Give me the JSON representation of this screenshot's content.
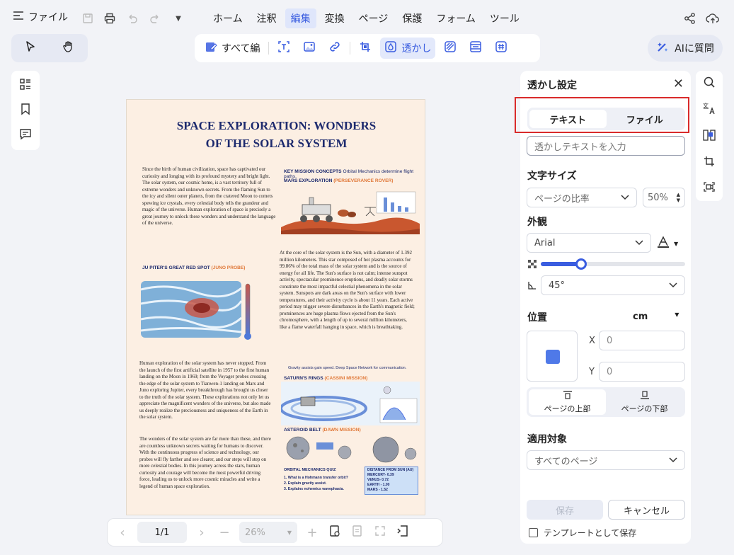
{
  "menubar": {
    "file_label": "ファイル",
    "tabs": [
      {
        "label": "ホーム",
        "active": false
      },
      {
        "label": "注釈",
        "active": false
      },
      {
        "label": "編集",
        "active": true
      },
      {
        "label": "変換",
        "active": false
      },
      {
        "label": "ページ",
        "active": false
      },
      {
        "label": "保護",
        "active": false
      },
      {
        "label": "フォーム",
        "active": false
      },
      {
        "label": "ツール",
        "active": false
      }
    ]
  },
  "toolbar": {
    "edit_all": "すべて編",
    "watermark": "透かし",
    "ai_button": "AIに質問"
  },
  "document": {
    "title_line1": "SPACE EXPLORATION: WONDERS",
    "title_line2": "OF THE SOLAR SYSTEM",
    "para1": "Since the birth of human civilization, space has captivated our curiosity and longing with its profound mystery and bright light. The solar system, our cosmic home, is a vast territory full of extreme wonders and unknown secrets. From the flaming Sun to the icy and silent outer planets, from the cratered Moon to comets spewing ice crystals, every celestial body tells the grandeur and magic of the universe. Human exploration of space is precisely a great journey to unlock these wonders and understand the language of the universe.",
    "key_mission": "KEY MISSION CONCEPTS",
    "key_mission_sub": "Orbital Mechanics determine flight paths.",
    "mars": "MARS EXPLORATION",
    "mars_sub": "(PERSEVERANCE ROVER)",
    "jupiter": "JU PITER'S GREAT RED SPOT",
    "jupiter_sub": "(JUNO PROBE)",
    "para2": "At the core of the solar system is the Sun, with a diameter of 1.392 million kilometers. This star composed of hot plasma accounts for 99.86% of the total mass of the solar system and is the source of energy for all life. The Sun's surface is not calm; intense sunspot activity, spectacular prominence eruptions, and deadly solar storms constitute the most impactful celestial phenomena in the solar system. Sunspots are dark areas on the Sun's surface with lower temperatures, and their activity cycle is about 11 years. Each active period may trigger severe disturbances in the Earth's magnetic field; prominences are huge plasma flows ejected from the Sun's chromosphere, with a length of up to several million kilometers, like a flame waterfall hanging in space, which is breathtaking.",
    "para3": "Human exploration of the solar system has never stopped. From the launch of the first artificial satellite in 1957 to the first human landing on the Moon in 1969; from the Voyager probes crossing the edge of the solar system to Tianwen-1 landing on Mars and Juno exploring Jupiter, every breakthrough has brought us closer to the truth of the solar system. These explorations not only let us appreciate the magnificent wonders of the universe, but also made us deeply realize the preciousness and uniqueness of the Earth in the solar system.",
    "para4": "The wonders of the solar system are far more than these, and there are countless unknown secrets waiting for humans to discover. With the continuous progress of science and technology, our probes will fly farther and see clearer, and our steps will step on more celestial bodies. In this journey across the stars, human curiosity and courage will become the most powerful driving force, leading us to unlock more cosmic miracles and write a legend of human space exploration.",
    "gravity": "Gravity assists gain speed. Deep Space Network for communication.",
    "saturn": "SATURN'S RINGS",
    "saturn_sub": "(CASSINI MISSION)",
    "asteroid": "ASTEROID BELT",
    "asteroid_sub": "(DAWN MISSION)",
    "quiz_title": "ORBITAL MECHANICS QUIZ",
    "quiz": [
      "1. What is a Hohmann transfer orbit?",
      "2. Explain gravity assist.",
      "3. Explains nohemics wavephasia."
    ],
    "dist_title": "DISTANCE FROM SUN (AU)",
    "dist": [
      "MERCURY- 0.39",
      "VENUS- 0.72",
      "EARTH - 1.00",
      "MARS - 1.52"
    ]
  },
  "bottom_nav": {
    "page": "1/1",
    "zoom": "26%"
  },
  "panel": {
    "title": "透かし設定",
    "tab_text": "テキスト",
    "tab_file": "ファイル",
    "text_placeholder": "透かしテキストを入力",
    "font_size_label": "文字サイズ",
    "size_mode": "ページの比率",
    "size_percent": "50%",
    "appearance_label": "外観",
    "font": "Arial",
    "opacity_percent": 0.28,
    "rotation": "45°",
    "position_label": "位置",
    "unit": "cm",
    "x_label": "X",
    "x_value": "0",
    "y_label": "Y",
    "y_value": "0",
    "page_top": "ページの上部",
    "page_bottom": "ページの下部",
    "apply_label": "適用対象",
    "apply_value": "すべてのページ",
    "save": "保存",
    "cancel": "キャンセル",
    "template_save": "テンプレートとして保存"
  },
  "colors": {
    "accent": "#3a5de0",
    "highlight_box": "#d92b2b",
    "doc_title": "#1d2a6e"
  }
}
